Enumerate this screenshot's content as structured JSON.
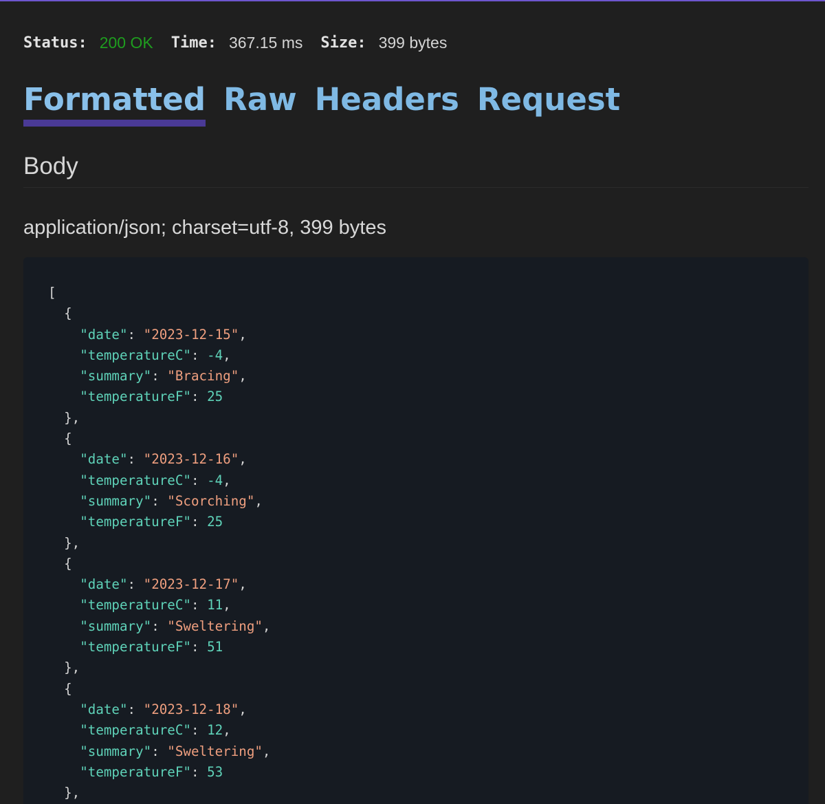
{
  "status_bar": {
    "status_label": "Status:",
    "status_value": "200 OK",
    "time_label": "Time:",
    "time_value": "367.15 ms",
    "size_label": "Size:",
    "size_value": "399 bytes"
  },
  "tabs": [
    {
      "label": "Formatted",
      "active": true
    },
    {
      "label": "Raw",
      "active": false
    },
    {
      "label": "Headers",
      "active": false
    },
    {
      "label": "Request",
      "active": false
    }
  ],
  "body": {
    "title": "Body",
    "content_type": "application/json; charset=utf-8, 399 bytes"
  },
  "json_body": [
    {
      "date": "2023-12-15",
      "temperatureC": -4,
      "summary": "Bracing",
      "temperatureF": 25
    },
    {
      "date": "2023-12-16",
      "temperatureC": -4,
      "summary": "Scorching",
      "temperatureF": 25
    },
    {
      "date": "2023-12-17",
      "temperatureC": 11,
      "summary": "Sweltering",
      "temperatureF": 51
    },
    {
      "date": "2023-12-18",
      "temperatureC": 12,
      "summary": "Sweltering",
      "temperatureF": 53
    }
  ],
  "colors": {
    "accent": "#6e56cf",
    "tab_underline": "#4a3a96",
    "tab_text": "#7fb9e4",
    "status_ok": "#1f9d1f",
    "json_key": "#5fd3b9",
    "json_string": "#ef9f7f",
    "json_number": "#5fd3b9",
    "code_background": "#161b22",
    "page_background": "#1f1f1f"
  }
}
